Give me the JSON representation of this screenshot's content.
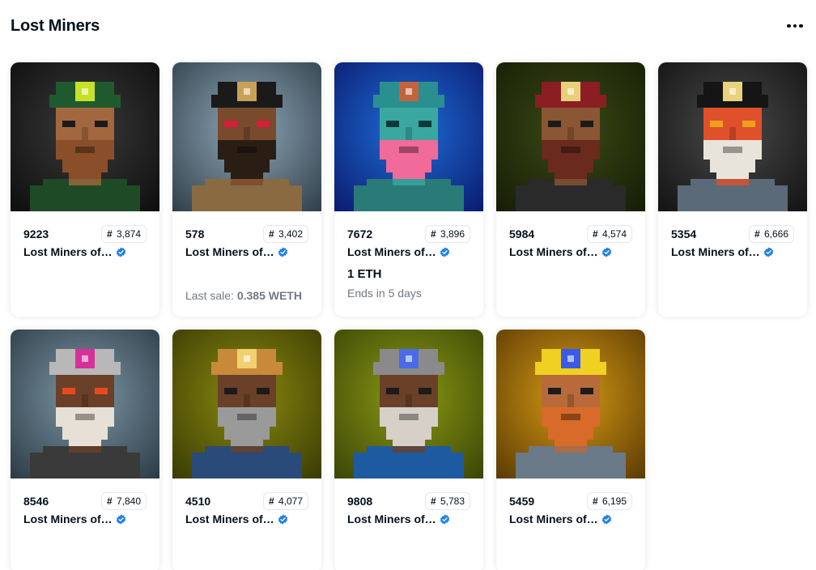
{
  "header": {
    "title": "Lost Miners",
    "more_icon": "ellipsis-icon"
  },
  "cards": [
    {
      "token": "9223",
      "rank": "3,874",
      "collection": "Lost Miners of…",
      "price": "",
      "sub": "",
      "last_sale_label": "",
      "last_sale_value": "",
      "palette": {
        "bg1": "#3a3a3a",
        "bg2": "#0d0d0d",
        "helmet": "#1f5a2e",
        "lamp": "#c8e02a",
        "skin": "#a3673f",
        "beard": "#8a4f2a",
        "eyes": "#1b1b1b",
        "body": "#1e4a25"
      }
    },
    {
      "token": "578",
      "rank": "3,402",
      "collection": "Lost Miners of…",
      "price": "",
      "sub": "",
      "last_sale_label": "Last sale:",
      "last_sale_value": "0.385 WETH",
      "palette": {
        "bg1": "#8fa8b8",
        "bg2": "#2f3e48",
        "helmet": "#1a1a1a",
        "lamp": "#c9a05a",
        "skin": "#7a4a2c",
        "beard": "#2a1d14",
        "eyes": "#d81e3c",
        "body": "#8a6a40"
      }
    },
    {
      "token": "7672",
      "rank": "3,896",
      "collection": "Lost Miners of…",
      "price": "1 ETH",
      "sub": "Ends in 5 days",
      "last_sale_label": "",
      "last_sale_value": "",
      "palette": {
        "bg1": "#1f6ed8",
        "bg2": "#0a1a6e",
        "helmet": "#2a8f8f",
        "lamp": "#c2643c",
        "skin": "#3aa8a0",
        "beard": "#f06a9a",
        "eyes": "#0f3a3a",
        "body": "#2a7a78"
      }
    },
    {
      "token": "5984",
      "rank": "4,574",
      "collection": "Lost Miners of…",
      "price": "",
      "sub": "",
      "last_sale_label": "",
      "last_sale_value": "",
      "palette": {
        "bg1": "#3a4a14",
        "bg2": "#161c06",
        "helmet": "#8a1e22",
        "lamp": "#e8d07a",
        "skin": "#8a5634",
        "beard": "#6a2a1c",
        "eyes": "#1b1b1b",
        "body": "#2a2a2a"
      }
    },
    {
      "token": "5354",
      "rank": "6,666",
      "collection": "Lost Miners of…",
      "price": "",
      "sub": "",
      "last_sale_label": "",
      "last_sale_value": "",
      "palette": {
        "bg1": "#4a4a4a",
        "bg2": "#121212",
        "helmet": "#151515",
        "lamp": "#e9d27c",
        "skin": "#e0502a",
        "beard": "#e8e4dc",
        "eyes": "#f0a020",
        "body": "#5a6a78"
      }
    },
    {
      "token": "8546",
      "rank": "7,840",
      "collection": "Lost Miners of…",
      "price": "",
      "sub": "",
      "last_sale_label": "",
      "last_sale_value": "",
      "palette": {
        "bg1": "#7e98a6",
        "bg2": "#2a3a44",
        "helmet": "#b8b8b8",
        "lamp": "#d6309a",
        "skin": "#6a4028",
        "beard": "#e6e0d6",
        "eyes": "#e84a1e",
        "body": "#3a3a3a"
      }
    },
    {
      "token": "4510",
      "rank": "4,077",
      "collection": "Lost Miners of…",
      "price": "",
      "sub": "",
      "last_sale_label": "",
      "last_sale_value": "",
      "palette": {
        "bg1": "#8a8a10",
        "bg2": "#3a3a04",
        "helmet": "#c88a3a",
        "lamp": "#f0d070",
        "skin": "#6a4028",
        "beard": "#9a9a9a",
        "eyes": "#1b1b1b",
        "body": "#2a4a7a"
      }
    },
    {
      "token": "9808",
      "rank": "5,783",
      "collection": "Lost Miners of…",
      "price": "",
      "sub": "",
      "last_sale_label": "",
      "last_sale_value": "",
      "palette": {
        "bg1": "#8a9a14",
        "bg2": "#3a4406",
        "helmet": "#8a8a8a",
        "lamp": "#4a6ae8",
        "skin": "#6a4028",
        "beard": "#d6d0c8",
        "eyes": "#1b1b1b",
        "body": "#1e5aa0"
      }
    },
    {
      "token": "5459",
      "rank": "6,195",
      "collection": "Lost Miners of…",
      "price": "",
      "sub": "",
      "last_sale_label": "",
      "last_sale_value": "",
      "palette": {
        "bg1": "#d69a14",
        "bg2": "#5a3a04",
        "helmet": "#f0d020",
        "lamp": "#3a5ae8",
        "skin": "#b86a3a",
        "beard": "#d86a2a",
        "eyes": "#1b1b1b",
        "body": "#6a7a88"
      }
    }
  ],
  "icons": {
    "verified": "verified-badge-icon",
    "art": "pixel-miner-artwork"
  },
  "colors": {
    "verified": "#2081e2",
    "muted": "#707a83",
    "text": "#04111d",
    "border": "#e5e8eb"
  }
}
